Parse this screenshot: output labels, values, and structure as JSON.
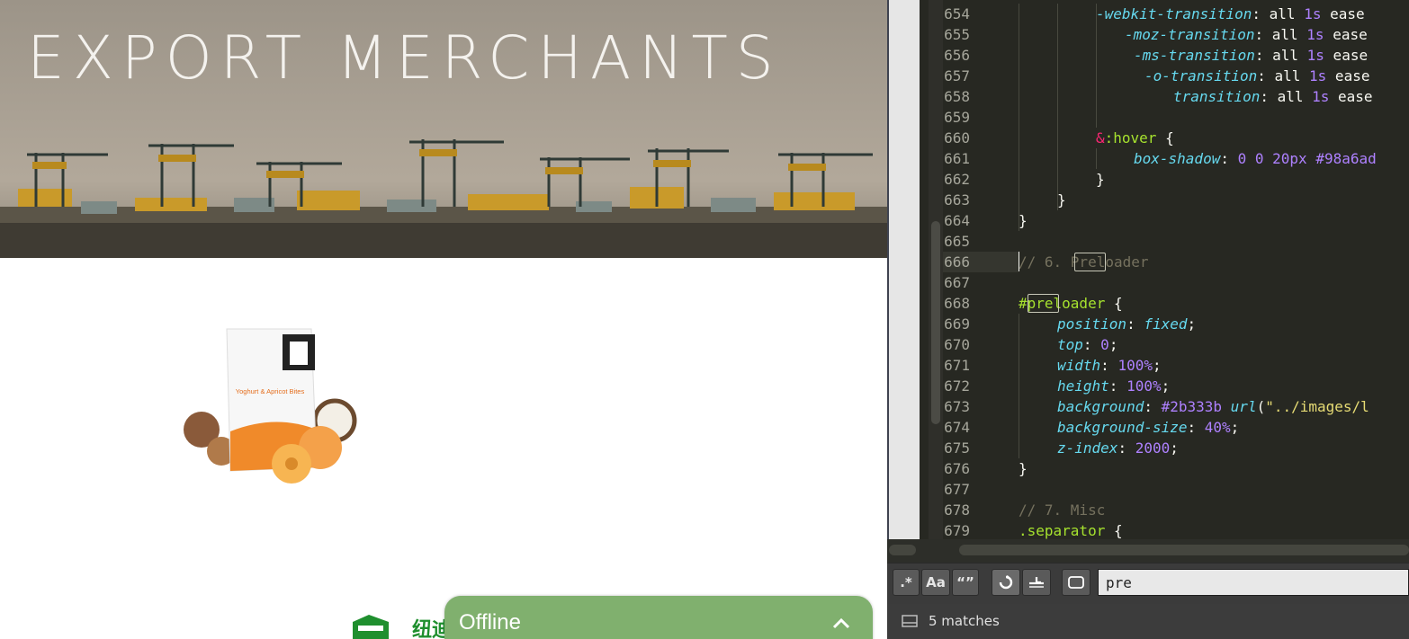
{
  "hero": {
    "title": "EXPORT MERCHANTS"
  },
  "product": {
    "brand_line": "Yoghurt & Apricot Bites"
  },
  "logo": {
    "text": "纽迪"
  },
  "chat": {
    "status": "Offline"
  },
  "editor": {
    "active_line": 666,
    "lines": [
      {
        "n": "654",
        "indent": 86,
        "t": [
          [
            "prop",
            "-webkit-transition"
          ],
          [
            "pl",
            ": all "
          ],
          [
            "num",
            "1s"
          ],
          [
            "pl",
            " ease"
          ]
        ]
      },
      {
        "n": "655",
        "indent": 118,
        "t": [
          [
            "prop",
            "-moz-transition"
          ],
          [
            "pl",
            ": all "
          ],
          [
            "num",
            "1s"
          ],
          [
            "pl",
            " ease"
          ]
        ]
      },
      {
        "n": "656",
        "indent": 128,
        "t": [
          [
            "prop",
            "-ms-transition"
          ],
          [
            "pl",
            ": all "
          ],
          [
            "num",
            "1s"
          ],
          [
            "pl",
            " ease"
          ]
        ]
      },
      {
        "n": "657",
        "indent": 140,
        "t": [
          [
            "prop",
            "-o-transition"
          ],
          [
            "pl",
            ": all "
          ],
          [
            "num",
            "1s"
          ],
          [
            "pl",
            " ease"
          ]
        ]
      },
      {
        "n": "658",
        "indent": 172,
        "t": [
          [
            "prop",
            "transition"
          ],
          [
            "pl",
            ": all "
          ],
          [
            "num",
            "1s"
          ],
          [
            "pl",
            " ease"
          ]
        ]
      },
      {
        "n": "659",
        "indent": 0,
        "t": []
      },
      {
        "n": "660",
        "indent": 86,
        "t": [
          [
            "amp",
            "&"
          ],
          [
            "sel",
            ":hover"
          ],
          [
            "pl",
            " {"
          ]
        ]
      },
      {
        "n": "661",
        "indent": 128,
        "t": [
          [
            "prop",
            "box-shadow"
          ],
          [
            "pl",
            ": "
          ],
          [
            "num",
            "0"
          ],
          [
            "pl",
            " "
          ],
          [
            "num",
            "0"
          ],
          [
            "pl",
            " "
          ],
          [
            "num",
            "20px"
          ],
          [
            "pl",
            " "
          ],
          [
            "num",
            "#98a6ad"
          ]
        ]
      },
      {
        "n": "662",
        "indent": 86,
        "t": [
          [
            "pl",
            "}"
          ]
        ]
      },
      {
        "n": "663",
        "indent": 43,
        "t": [
          [
            "pl",
            "}"
          ]
        ]
      },
      {
        "n": "664",
        "indent": 0,
        "t": [
          [
            "pl",
            "}"
          ]
        ]
      },
      {
        "n": "665",
        "indent": 0,
        "t": []
      },
      {
        "n": "666",
        "indent": 0,
        "t": [
          [
            "comment",
            "// 6. Preloader"
          ]
        ]
      },
      {
        "n": "667",
        "indent": 0,
        "t": []
      },
      {
        "n": "668",
        "indent": 0,
        "t": [
          [
            "sel",
            "#preloader"
          ],
          [
            "pl",
            " {"
          ]
        ]
      },
      {
        "n": "669",
        "indent": 43,
        "t": [
          [
            "prop",
            "position"
          ],
          [
            "pl",
            ": "
          ],
          [
            "prop",
            "fixed"
          ],
          [
            "pl",
            ";"
          ]
        ]
      },
      {
        "n": "670",
        "indent": 43,
        "t": [
          [
            "prop",
            "top"
          ],
          [
            "pl",
            ": "
          ],
          [
            "num",
            "0"
          ],
          [
            "pl",
            ";"
          ]
        ]
      },
      {
        "n": "671",
        "indent": 43,
        "t": [
          [
            "prop",
            "width"
          ],
          [
            "pl",
            ": "
          ],
          [
            "num",
            "100%"
          ],
          [
            "pl",
            ";"
          ]
        ]
      },
      {
        "n": "672",
        "indent": 43,
        "t": [
          [
            "prop",
            "height"
          ],
          [
            "pl",
            ": "
          ],
          [
            "num",
            "100%"
          ],
          [
            "pl",
            ";"
          ]
        ]
      },
      {
        "n": "673",
        "indent": 43,
        "t": [
          [
            "prop",
            "background"
          ],
          [
            "pl",
            ": "
          ],
          [
            "num",
            "#2b333b"
          ],
          [
            "pl",
            " "
          ],
          [
            "url",
            "url"
          ],
          [
            "pl",
            "("
          ],
          [
            "str",
            "\"../images/l"
          ]
        ]
      },
      {
        "n": "674",
        "indent": 43,
        "t": [
          [
            "prop",
            "background-size"
          ],
          [
            "pl",
            ": "
          ],
          [
            "num",
            "40%"
          ],
          [
            "pl",
            ";"
          ]
        ]
      },
      {
        "n": "675",
        "indent": 43,
        "t": [
          [
            "prop",
            "z-index"
          ],
          [
            "pl",
            ": "
          ],
          [
            "num",
            "2000"
          ],
          [
            "pl",
            ";"
          ]
        ]
      },
      {
        "n": "676",
        "indent": 0,
        "t": [
          [
            "pl",
            "}"
          ]
        ]
      },
      {
        "n": "677",
        "indent": 0,
        "t": []
      },
      {
        "n": "678",
        "indent": 0,
        "t": [
          [
            "comment",
            "// 7. Misc"
          ]
        ]
      },
      {
        "n": "679",
        "indent": 0,
        "t": [
          [
            "sel",
            ".separator"
          ],
          [
            "pl",
            " {"
          ]
        ]
      }
    ]
  },
  "findbar": {
    "regex_label": ".*",
    "case_label": "Aa",
    "word_label": "“”",
    "query": "pre"
  },
  "status": {
    "matches": "5 matches"
  },
  "colors": {
    "editor_bg": "#272822",
    "chat_green": "#80b06e",
    "property": "#66d9ef",
    "number": "#ae81ff",
    "selector": "#a6e22e",
    "comment": "#75715e"
  }
}
